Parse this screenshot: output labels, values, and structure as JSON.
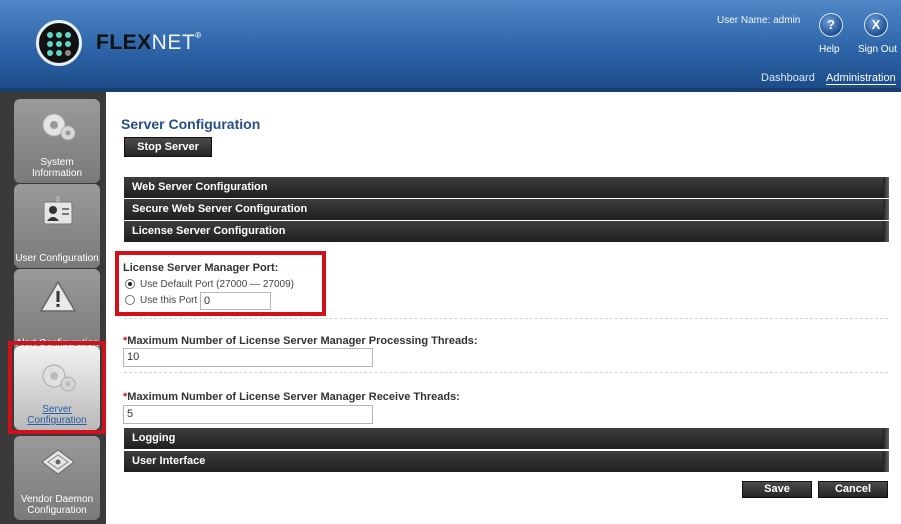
{
  "header": {
    "brand_bold": "FLEX",
    "brand_thin": "NET",
    "brand_mark": "®",
    "username": "User Name: admin",
    "help_label": "Help",
    "signout_label": "Sign Out",
    "help_glyph": "?",
    "signout_glyph": "X",
    "nav": [
      "Dashboard",
      "Administration"
    ],
    "nav_active": "Administration"
  },
  "sidebar": {
    "items": [
      {
        "label": "System Information",
        "icon": "gears-icon"
      },
      {
        "label": "User Configuration",
        "icon": "user-card-icon"
      },
      {
        "label": "Alert Configuration",
        "icon": "warning-icon"
      },
      {
        "label": "Server Configuration",
        "icon": "gears-icon",
        "active": true
      },
      {
        "label": "Vendor Daemon Configuration",
        "icon": "certificate-icon"
      }
    ]
  },
  "main": {
    "title": "Server Configuration",
    "stop_button": "Stop Server",
    "sections": [
      "Web Server Configuration",
      "Secure Web Server Configuration",
      "License Server Configuration",
      "Logging",
      "User Interface"
    ],
    "port": {
      "label": "License Server Manager Port:",
      "default_option": "Use Default Port (27000 — 27009)",
      "custom_option": "Use this Port",
      "custom_value": "0",
      "selected": "default"
    },
    "processing_threads": {
      "required_mark": "*",
      "label": "Maximum Number of License Server Manager Processing Threads:",
      "value": "10"
    },
    "receive_threads": {
      "required_mark": "*",
      "label": "Maximum Number of License Server Manager Receive Threads:",
      "value": "5"
    },
    "save_button": "Save",
    "cancel_button": "Cancel"
  },
  "colors": {
    "header_blue": "#2d64a8",
    "title_blue": "#284e86",
    "highlight_red": "#d0101b",
    "section_bar": "#2a2a2a"
  }
}
